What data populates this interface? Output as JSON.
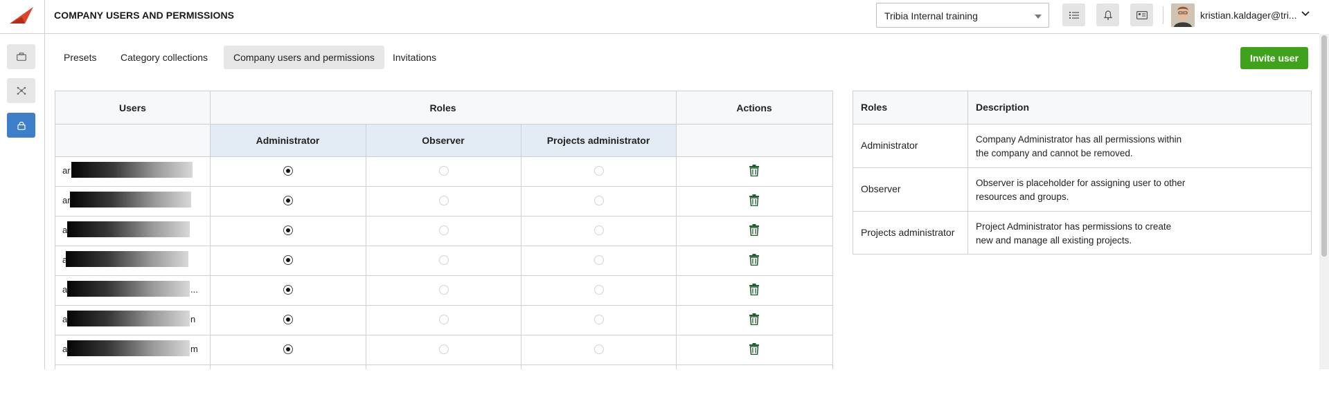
{
  "app": {
    "page_title": "COMPANY USERS AND PERMISSIONS",
    "organization_select": {
      "value": "Tribia Internal training"
    },
    "user_menu": {
      "name": "kristian.kaldager@tri..."
    }
  },
  "tabs": [
    {
      "label": "Presets",
      "active": false
    },
    {
      "label": "Category collections",
      "active": false
    },
    {
      "label": "Company users and permissions",
      "active": true
    },
    {
      "label": "Invitations",
      "active": false
    }
  ],
  "invite_button": {
    "label": "Invite user",
    "color": "#3fa21c"
  },
  "users_table": {
    "headers": {
      "users": "Users",
      "roles": "Roles",
      "actions": "Actions"
    },
    "role_columns": [
      "Administrator",
      "Observer",
      "Projects administrator"
    ],
    "rows": [
      {
        "email_prefix": "ar",
        "email_suffix": "",
        "role": "Administrator"
      },
      {
        "email_prefix": "ar",
        "email_suffix": "",
        "role": "Administrator"
      },
      {
        "email_prefix": "a",
        "email_suffix": "",
        "role": "Administrator"
      },
      {
        "email_prefix": "a",
        "email_suffix": "",
        "role": "Administrator"
      },
      {
        "email_prefix": "a",
        "email_suffix": "...",
        "role": "Administrator"
      },
      {
        "email_prefix": "a",
        "email_suffix": "n",
        "role": "Administrator"
      },
      {
        "email_prefix": "a",
        "email_suffix": "m",
        "role": "Administrator"
      }
    ]
  },
  "roles_table": {
    "headers": {
      "roles": "Roles",
      "description": "Description"
    },
    "rows": [
      {
        "role": "Administrator",
        "description_line1": "Company Administrator has all permissions within",
        "description_line2": "the company and cannot be removed."
      },
      {
        "role": "Observer",
        "description_line1": "Observer is placeholder for assigning user to other",
        "description_line2": "resources and groups."
      },
      {
        "role": "Projects administrator",
        "description_line1": "Project Administrator has permissions to create",
        "description_line2": "new and manage all existing projects."
      }
    ]
  },
  "colors": {
    "accent": "#3d7fc8",
    "logo": "#e0432b",
    "header_highlight": "#e3ebf4"
  }
}
